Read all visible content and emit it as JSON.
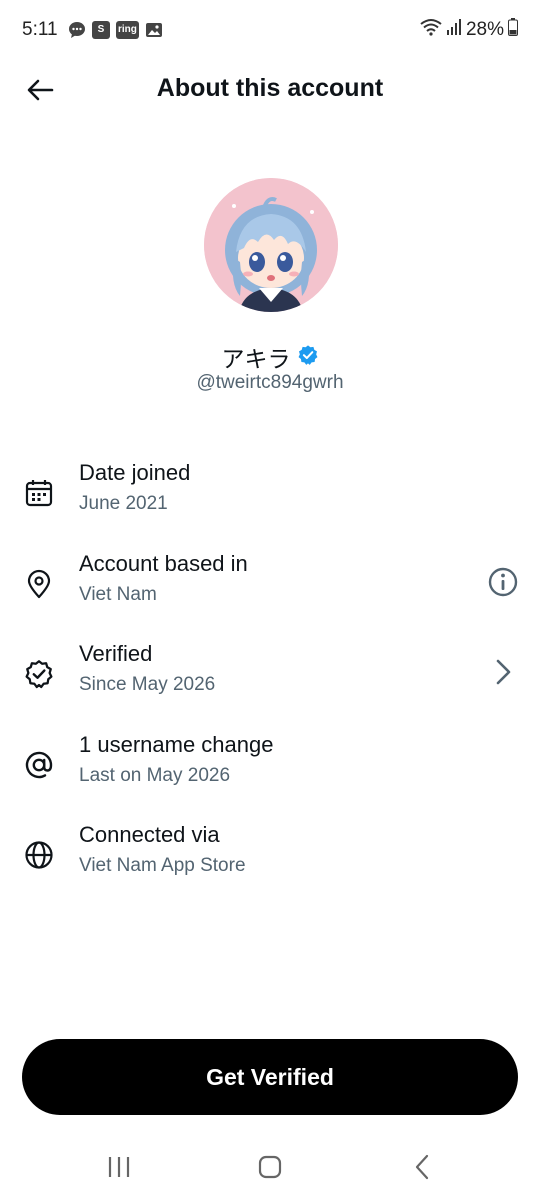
{
  "status_bar": {
    "time": "5:11",
    "left_icons": [
      "chat-bubble-icon",
      "s-app-icon",
      "ring-app-icon",
      "gallery-icon"
    ],
    "ring_label": "ring",
    "s_label": "S",
    "battery": "28%"
  },
  "header": {
    "title": "About this account"
  },
  "profile": {
    "display_name": "アキラ",
    "handle": "@tweirtc894gwrh",
    "verified": true,
    "verified_color": "#1d9bf0"
  },
  "info_rows": [
    {
      "icon": "calendar-icon",
      "title": "Date joined",
      "subtitle": "June 2021",
      "action": null
    },
    {
      "icon": "location-pin-icon",
      "title": "Account based in",
      "subtitle": "Viet Nam",
      "action": "info-icon"
    },
    {
      "icon": "verified-badge-icon",
      "title": "Verified",
      "subtitle": "Since May 2026",
      "action": "chevron-right-icon"
    },
    {
      "icon": "at-sign-icon",
      "title": "1 username change",
      "subtitle": "Last on May 2026",
      "action": null
    },
    {
      "icon": "globe-icon",
      "title": "Connected via",
      "subtitle": "Viet Nam App Store",
      "action": null
    }
  ],
  "cta": {
    "label": "Get Verified"
  },
  "nav_bar": {
    "buttons": [
      "recent-apps-icon",
      "home-icon",
      "back-icon"
    ]
  }
}
